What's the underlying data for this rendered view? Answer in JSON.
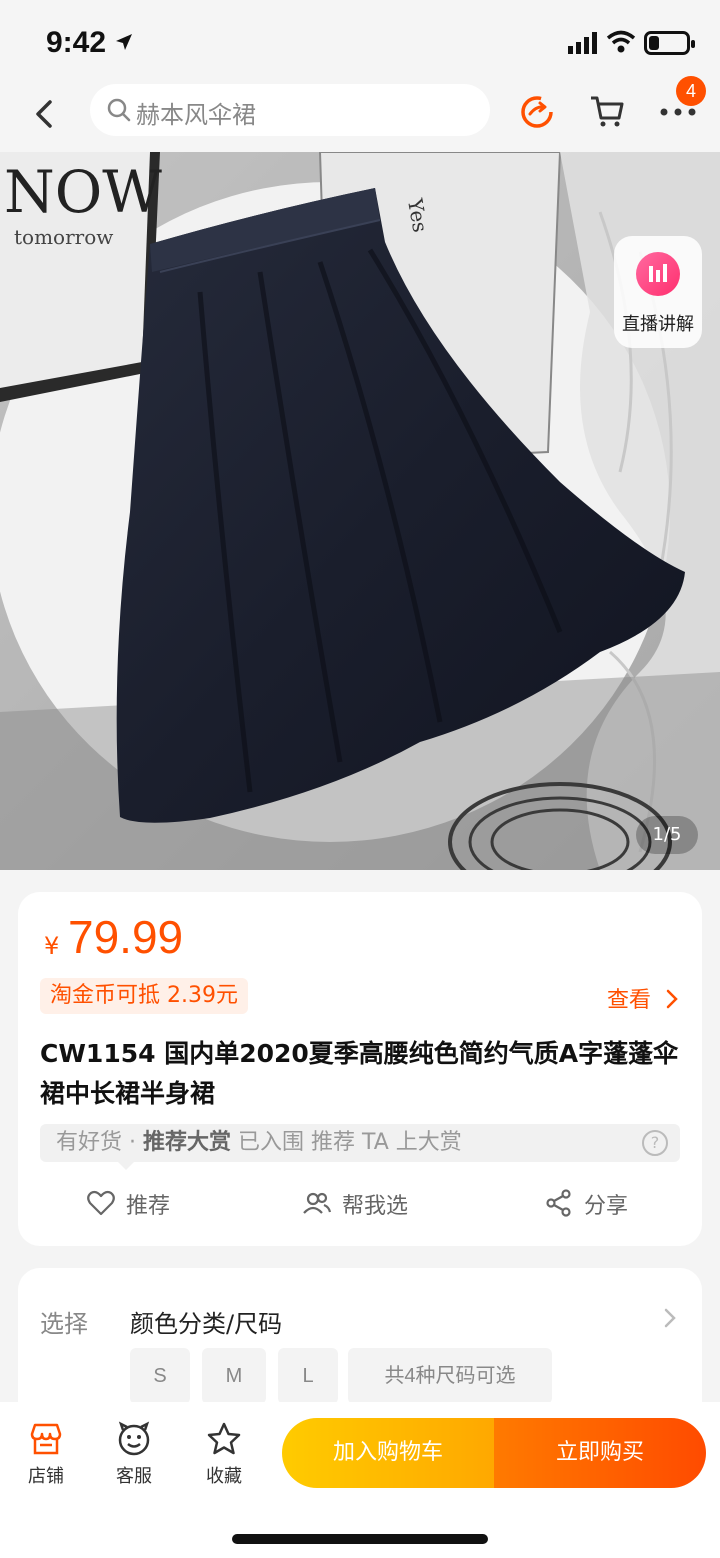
{
  "status_bar": {
    "time": "9:42"
  },
  "nav": {
    "search_placeholder": "赫本风伞裙",
    "cart_badge": "4",
    "icons": [
      "back-icon",
      "search-icon",
      "share-live-icon",
      "cart-icon",
      "more-icon"
    ]
  },
  "hero": {
    "counter": "1/5",
    "live_label": "直播讲解",
    "prints": [
      "NOW",
      "tomorrow",
      "Yes"
    ]
  },
  "product": {
    "currency": "¥",
    "price": "79.99",
    "coin_tag": "淘金币可抵 2.39元",
    "view_link": "查看",
    "title": "CW1154 国内单2020夏季高腰纯色简约气质A字蓬蓬伞裙中长裙半身裙",
    "promo_prefix": "有好货 · ",
    "promo_strong": "推荐大赏",
    "promo_suffix": " 已入围 推荐 TA 上大赏",
    "help": "?",
    "actions": [
      {
        "label": "推荐"
      },
      {
        "label": "帮我选"
      },
      {
        "label": "分享"
      }
    ]
  },
  "selection": {
    "label": "选择",
    "value": "颜色分类/尺码",
    "sizes": [
      "S",
      "M",
      "L"
    ],
    "more": "共4种尺码可选"
  },
  "bottom": {
    "tabs": [
      {
        "label": "店铺"
      },
      {
        "label": "客服"
      },
      {
        "label": "收藏"
      }
    ],
    "add_cart": "加入购物车",
    "buy_now": "立即购买"
  },
  "colors": {
    "accent": "#ff5000",
    "cart_btn": "#ffb800",
    "buy_btn": "#ff5a00"
  }
}
